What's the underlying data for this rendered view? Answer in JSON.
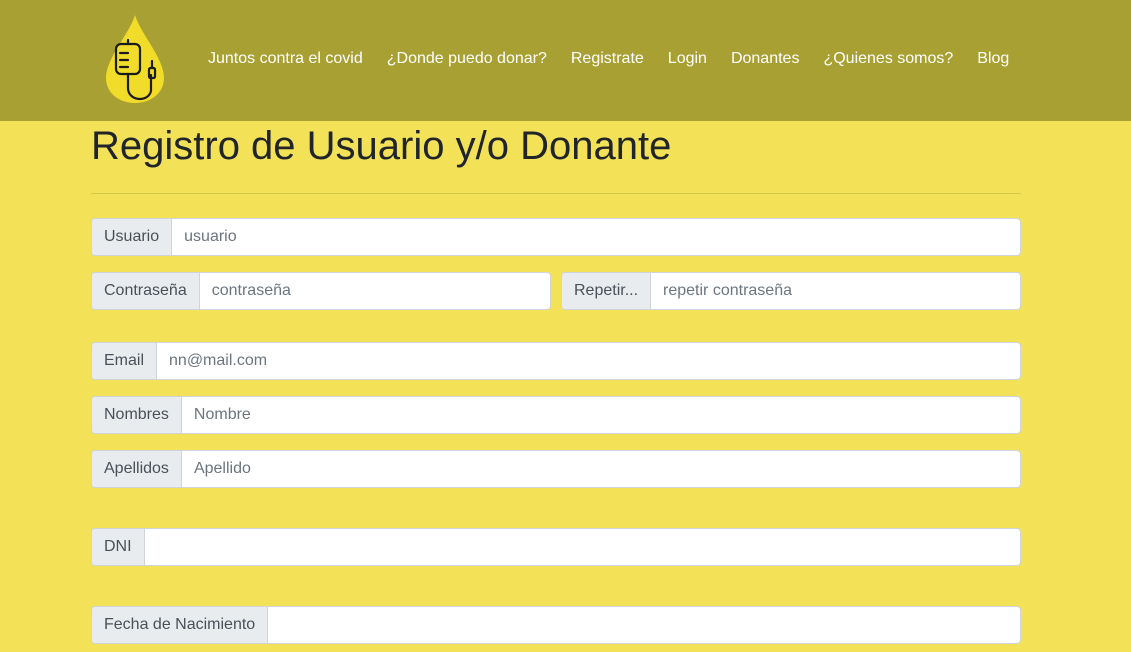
{
  "nav": {
    "links": [
      "Juntos contra el covid",
      "¿Donde puedo donar?",
      "Registrate",
      "Login",
      "Donantes",
      "¿Quienes somos?",
      "Blog"
    ]
  },
  "page": {
    "title": "Registro de Usuario y/o Donante"
  },
  "form": {
    "usuario": {
      "label": "Usuario",
      "placeholder": "usuario"
    },
    "password": {
      "label": "Contraseña",
      "placeholder": "contraseña"
    },
    "repeat": {
      "label": "Repetir...",
      "placeholder": "repetir contraseña"
    },
    "email": {
      "label": "Email",
      "placeholder": "nn@mail.com"
    },
    "nombres": {
      "label": "Nombres",
      "placeholder": "Nombre"
    },
    "apellidos": {
      "label": "Apellidos",
      "placeholder": "Apellido"
    },
    "dni": {
      "label": "DNI",
      "placeholder": ""
    },
    "fecha": {
      "label": "Fecha de Nacimiento",
      "placeholder": ""
    }
  },
  "colors": {
    "navbar": "#a8a033",
    "background": "#f3e257",
    "logo_drop": "#f2dc2a"
  },
  "icons": {
    "logo": "blood-drop-iv-bag-icon"
  }
}
